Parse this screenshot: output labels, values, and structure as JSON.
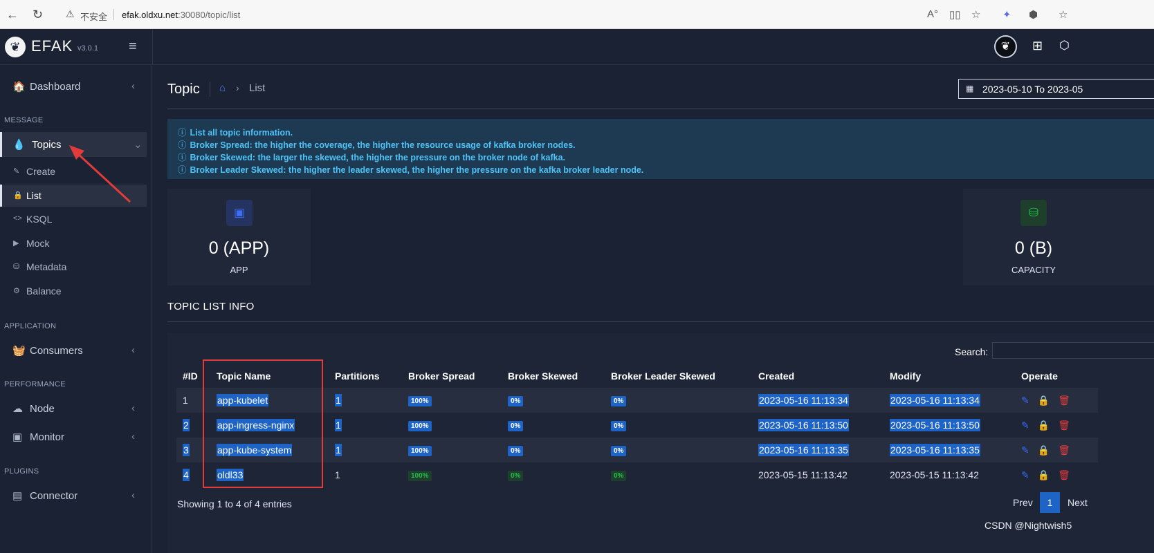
{
  "browser": {
    "back_icon": "←",
    "reload_icon": "↻",
    "warning_icon": "⚠",
    "insecure_text": "不安全",
    "url_host": "efak.oldxu.net",
    "url_rest": ":30080/topic/list"
  },
  "header": {
    "logo_icon": "feather-icon",
    "brand": "EFAK",
    "version": "v3.0.1",
    "hamburger_icon": "≡",
    "apps_icon": "⊞",
    "box_icon": "⬡"
  },
  "sidebar": {
    "dashboard": {
      "icon": "🏠",
      "label": "Dashboard",
      "chev": "‹"
    },
    "message_label": "MESSAGE",
    "topics": {
      "icon": "💧",
      "label": "Topics",
      "chev": "⌄"
    },
    "sub_items": [
      {
        "icon": "✎",
        "label": "Create"
      },
      {
        "icon": "🔒",
        "label": "List"
      },
      {
        "icon": "<>",
        "label": "KSQL"
      },
      {
        "icon": "▶",
        "label": "Mock"
      },
      {
        "icon": "⛁",
        "label": "Metadata"
      },
      {
        "icon": "⚙",
        "label": "Balance"
      }
    ],
    "application_label": "APPLICATION",
    "consumers": {
      "icon": "🧺",
      "label": "Consumers",
      "chev": "‹"
    },
    "performance_label": "PERFORMANCE",
    "node": {
      "icon": "☁",
      "label": "Node",
      "chev": "‹"
    },
    "monitor": {
      "icon": "▣",
      "label": "Monitor",
      "chev": "‹"
    },
    "plugins_label": "PLUGINS",
    "connector": {
      "icon": "▤",
      "label": "Connector",
      "chev": "‹"
    }
  },
  "main": {
    "title": "Topic",
    "breadcrumb_current": "List",
    "date_range": "2023-05-10 To 2023-05",
    "info_lines": [
      "List all topic information.",
      "Broker Spread: the higher the coverage, the higher the resource usage of kafka broker nodes.",
      "Broker Skewed: the larger the skewed, the higher the pressure on the broker node of kafka.",
      "Broker Leader Skewed: the higher the leader skewed, the higher the pressure on the kafka broker leader node."
    ],
    "stats": [
      {
        "value": "0 (APP)",
        "caption": "APP",
        "icon": "archive-icon",
        "color": "#3d6df2"
      },
      {
        "value": "0 (B)",
        "caption": "CAPACITY",
        "icon": "database-icon",
        "color": "#1fc14a"
      }
    ],
    "section_title": "TOPIC LIST INFO",
    "search_label": "Search:",
    "table": {
      "columns": [
        "#ID",
        "Topic Name",
        "Partitions",
        "Broker Spread",
        "Broker Skewed",
        "Broker Leader Skewed",
        "Created",
        "Modify",
        "Operate"
      ],
      "rows": [
        {
          "id": "1",
          "name": "app-kubelet",
          "partitions": "1",
          "spread": "100%",
          "skewed": "0%",
          "leader_skewed": "0%",
          "created": "2023-05-16 11:13:34",
          "modify": "2023-05-16 11:13:34"
        },
        {
          "id": "2",
          "name": "app-ingress-nginx",
          "partitions": "1",
          "spread": "100%",
          "skewed": "0%",
          "leader_skewed": "0%",
          "created": "2023-05-16 11:13:50",
          "modify": "2023-05-16 11:13:50"
        },
        {
          "id": "3",
          "name": "app-kube-system",
          "partitions": "1",
          "spread": "100%",
          "skewed": "0%",
          "leader_skewed": "0%",
          "created": "2023-05-16 11:13:35",
          "modify": "2023-05-16 11:13:35"
        },
        {
          "id": "4",
          "name": "oldl33",
          "partitions": "1",
          "spread": "100%",
          "skewed": "0%",
          "leader_skewed": "0%",
          "created": "2023-05-15 11:13:42",
          "modify": "2023-05-15 11:13:42"
        }
      ]
    },
    "entries_info": "Showing 1 to 4 of 4 entries",
    "pagination": {
      "prev": "Prev",
      "current": "1",
      "next": "Next"
    },
    "watermark": "CSDN @Nightwish5"
  },
  "colors": {
    "accent_blue": "#1e63c6",
    "info_text": "#4fc3f7",
    "annotation_red": "#e23b3b"
  }
}
